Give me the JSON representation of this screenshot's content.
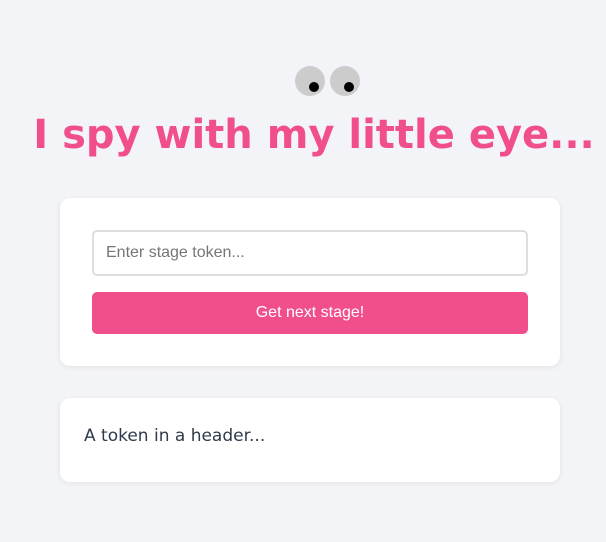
{
  "header": {
    "icon": "googly-eyes-icon",
    "title": "I spy with my little eye..."
  },
  "form": {
    "token_placeholder": "Enter stage token...",
    "token_value": "",
    "submit_label": "Get next stage!"
  },
  "hint": {
    "text": "A token in a header..."
  },
  "colors": {
    "accent": "#f14f8c",
    "background": "#f3f4f8",
    "card": "#ffffff",
    "eye_white": "#cccccc",
    "pupil": "#000000",
    "hint_text": "#2f3b4a"
  }
}
